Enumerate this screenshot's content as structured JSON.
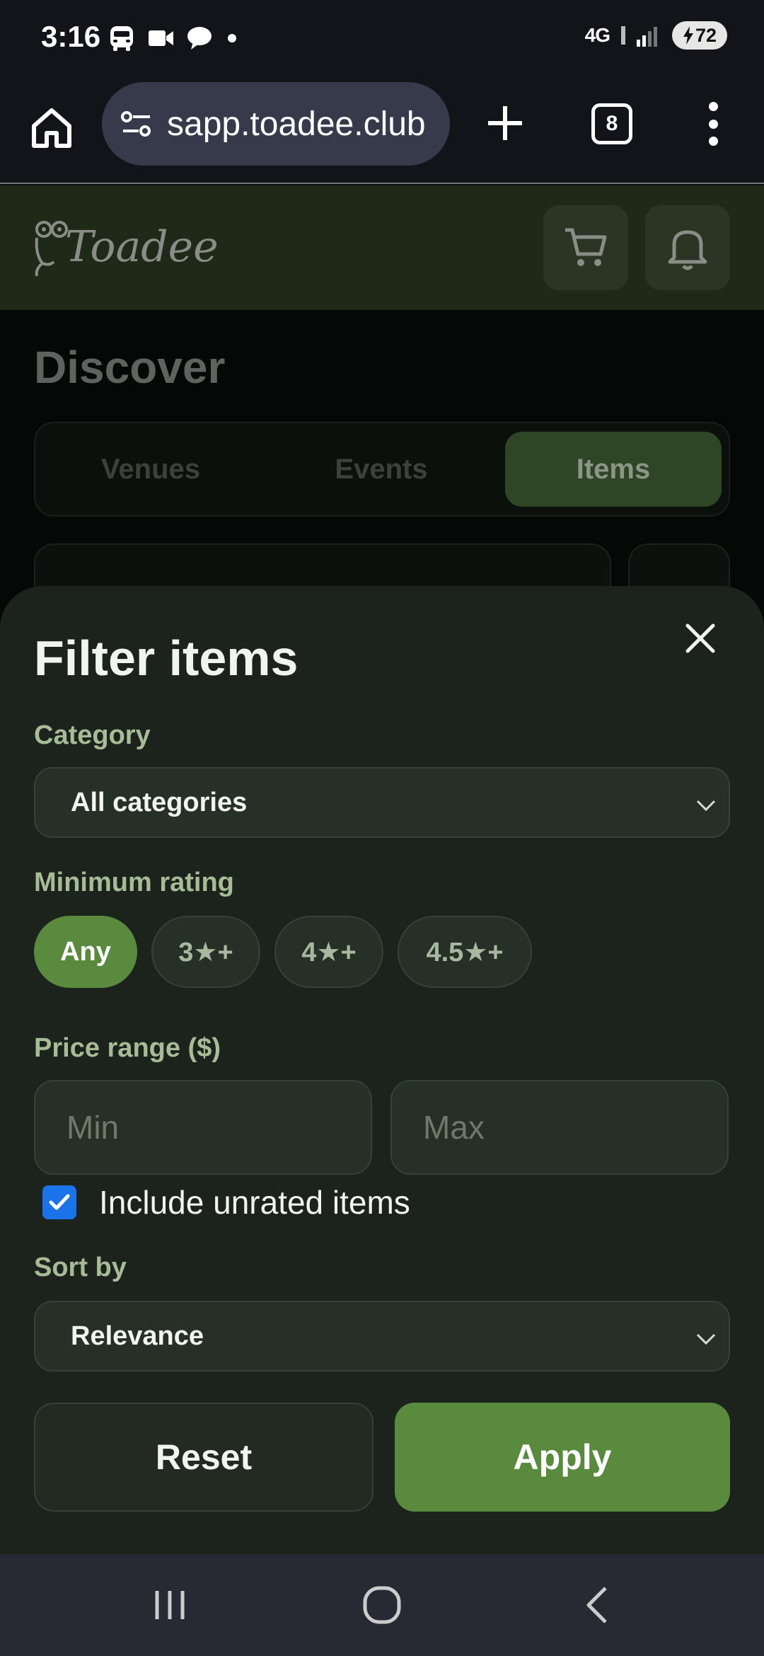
{
  "status_bar": {
    "time": "3:16",
    "network": "4G",
    "battery": "72",
    "icons": [
      "bus-icon",
      "video-call-icon",
      "chat-bubble-icon",
      "dot-icon",
      "lte-icon",
      "signal-icon",
      "battery-charging-icon"
    ]
  },
  "browser": {
    "url": "sapp.toadee.club",
    "tab_count": "8"
  },
  "app": {
    "logo_text": "Toadee",
    "page_title": "Discover",
    "tabs": [
      {
        "label": "Venues",
        "active": false
      },
      {
        "label": "Events",
        "active": false
      },
      {
        "label": "Items",
        "active": true
      }
    ]
  },
  "filter_sheet": {
    "title": "Filter items",
    "category": {
      "label": "Category",
      "value": "All categories"
    },
    "min_rating": {
      "label": "Minimum rating",
      "options": [
        "Any",
        "3★+",
        "4★+",
        "4.5★+"
      ],
      "selected": "Any"
    },
    "price_range": {
      "label": "Price range ($)",
      "min_placeholder": "Min",
      "max_placeholder": "Max"
    },
    "include_unrated": {
      "label": "Include unrated items",
      "checked": true
    },
    "sort_by": {
      "label": "Sort by",
      "value": "Relevance"
    },
    "reset_label": "Reset",
    "apply_label": "Apply"
  },
  "colors": {
    "accent_green": "#5a8a3e",
    "sheet_bg": "#1c231c",
    "label_green": "#a6bc96",
    "checkbox_blue": "#1a73e8"
  }
}
